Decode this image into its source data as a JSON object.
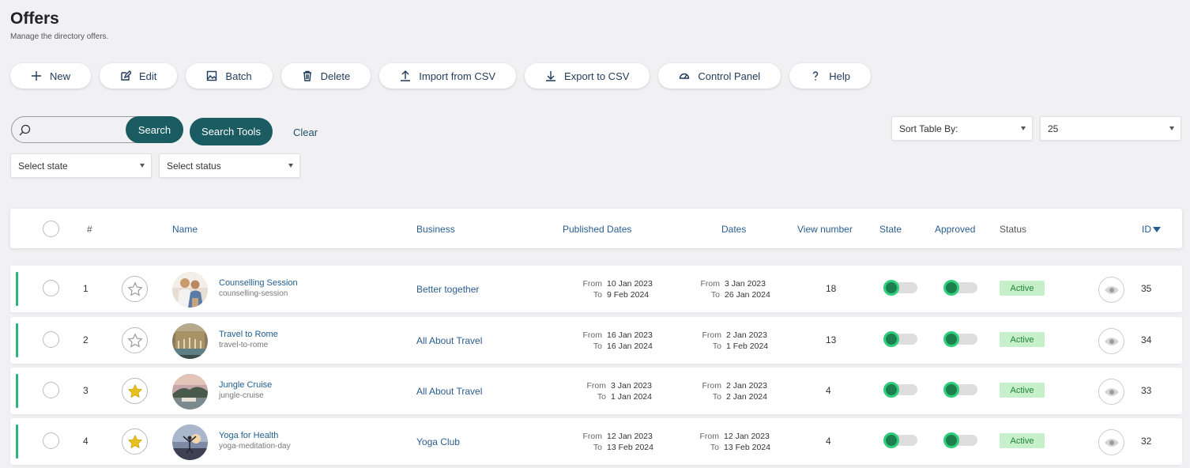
{
  "page": {
    "title": "Offers",
    "subtitle": "Manage the directory offers."
  },
  "toolbar": [
    {
      "label": "New",
      "icon": "plus-icon"
    },
    {
      "label": "Edit",
      "icon": "edit-icon"
    },
    {
      "label": "Batch",
      "icon": "image-icon"
    },
    {
      "label": "Delete",
      "icon": "trash-icon"
    },
    {
      "label": "Import from CSV",
      "icon": "upload-icon"
    },
    {
      "label": "Export to CSV",
      "icon": "download-icon"
    },
    {
      "label": "Control Panel",
      "icon": "dashboard-icon"
    },
    {
      "label": "Help",
      "icon": "help-icon"
    }
  ],
  "search": {
    "placeholder": "",
    "value": "",
    "button": "Search",
    "tools": "Search Tools",
    "clear": "Clear"
  },
  "filters": {
    "state": "Select state",
    "status": "Select status"
  },
  "sort": {
    "label": "Sort Table By:",
    "per_page": "25"
  },
  "columns": {
    "number": "#",
    "name": "Name",
    "business": "Business",
    "published": "Published Dates",
    "dates": "Dates",
    "views": "View number",
    "state": "State",
    "approved": "Approved",
    "status": "Status",
    "id": "ID"
  },
  "labels": {
    "from": "From",
    "to": "To"
  },
  "rows": [
    {
      "num": "1",
      "name": "Counselling Session",
      "alias": "counselling-session",
      "business": "Better together",
      "pub_from": "10 Jan 2023",
      "pub_to": "9 Feb 2024",
      "from": "3 Jan 2023",
      "to": "26 Jan 2024",
      "views": "18",
      "status": "Active",
      "id": "35",
      "featured": false
    },
    {
      "num": "2",
      "name": "Travel to Rome",
      "alias": "travel-to-rome",
      "business": "All About Travel",
      "pub_from": "16 Jan 2023",
      "pub_to": "16 Jan 2024",
      "from": "2 Jan 2023",
      "to": "1 Feb 2024",
      "views": "13",
      "status": "Active",
      "id": "34",
      "featured": false
    },
    {
      "num": "3",
      "name": "Jungle Cruise",
      "alias": "jungle-cruise",
      "business": "All About Travel",
      "pub_from": "3 Jan 2023",
      "pub_to": "1 Jan 2024",
      "from": "2 Jan 2023",
      "to": "2 Jan 2024",
      "views": "4",
      "status": "Active",
      "id": "33",
      "featured": true
    },
    {
      "num": "4",
      "name": "Yoga for Health",
      "alias": "yoga-meditation-day",
      "business": "Yoga Club",
      "pub_from": "12 Jan 2023",
      "pub_to": "13 Feb 2024",
      "from": "12 Jan 2023",
      "to": "13 Feb 2024",
      "views": "4",
      "status": "Active",
      "id": "32",
      "featured": true
    }
  ],
  "colors": {
    "accent": "#1a5c62",
    "link": "#2a5d8f",
    "active_bar": "#2db37a",
    "star": "#e8c21a",
    "badge_bg": "#c6f0c9"
  }
}
